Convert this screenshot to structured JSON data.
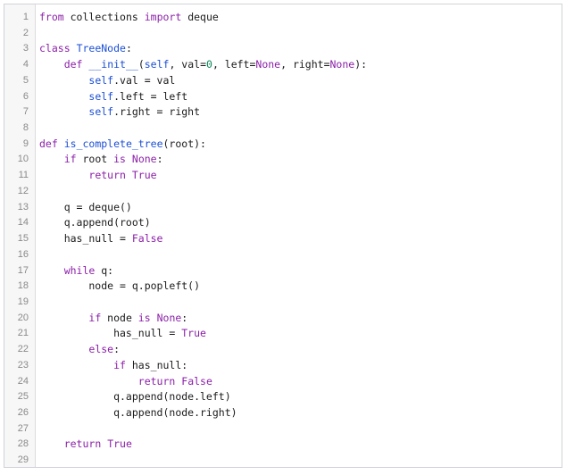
{
  "colors": {
    "default": "#1a1a1a",
    "keyword": "#8b1fa8",
    "builtin": "#1c4fd6",
    "number": "#098658",
    "line_number": "#8a8a8a",
    "gutter_bg": "#f7f7f7"
  },
  "editor": {
    "language": "python",
    "lines": [
      {
        "n": "1",
        "tokens": [
          [
            "kw",
            "from"
          ],
          [
            "t",
            " collections "
          ],
          [
            "kw",
            "import"
          ],
          [
            "t",
            " deque"
          ]
        ]
      },
      {
        "n": "2",
        "tokens": []
      },
      {
        "n": "3",
        "tokens": [
          [
            "kw",
            "class"
          ],
          [
            "t",
            " "
          ],
          [
            "bi",
            "TreeNode"
          ],
          [
            "t",
            ":"
          ]
        ]
      },
      {
        "n": "4",
        "tokens": [
          [
            "t",
            "    "
          ],
          [
            "kw",
            "def"
          ],
          [
            "t",
            " "
          ],
          [
            "bi",
            "__init__"
          ],
          [
            "t",
            "("
          ],
          [
            "bi",
            "self"
          ],
          [
            "t",
            ", val="
          ],
          [
            "num",
            "0"
          ],
          [
            "t",
            ", left="
          ],
          [
            "kw",
            "None"
          ],
          [
            "t",
            ", right="
          ],
          [
            "kw",
            "None"
          ],
          [
            "t",
            "):"
          ]
        ]
      },
      {
        "n": "5",
        "tokens": [
          [
            "t",
            "        "
          ],
          [
            "bi",
            "self"
          ],
          [
            "t",
            ".val = val"
          ]
        ]
      },
      {
        "n": "6",
        "tokens": [
          [
            "t",
            "        "
          ],
          [
            "bi",
            "self"
          ],
          [
            "t",
            ".left = left"
          ]
        ]
      },
      {
        "n": "7",
        "tokens": [
          [
            "t",
            "        "
          ],
          [
            "bi",
            "self"
          ],
          [
            "t",
            ".right = right"
          ]
        ]
      },
      {
        "n": "8",
        "tokens": []
      },
      {
        "n": "9",
        "tokens": [
          [
            "kw",
            "def"
          ],
          [
            "t",
            " "
          ],
          [
            "bi",
            "is_complete_tree"
          ],
          [
            "t",
            "(root):"
          ]
        ]
      },
      {
        "n": "10",
        "tokens": [
          [
            "t",
            "    "
          ],
          [
            "kw",
            "if"
          ],
          [
            "t",
            " root "
          ],
          [
            "kw",
            "is"
          ],
          [
            "t",
            " "
          ],
          [
            "kw",
            "None"
          ],
          [
            "t",
            ":"
          ]
        ]
      },
      {
        "n": "11",
        "tokens": [
          [
            "t",
            "        "
          ],
          [
            "kw",
            "return"
          ],
          [
            "t",
            " "
          ],
          [
            "kw",
            "True"
          ]
        ]
      },
      {
        "n": "12",
        "tokens": []
      },
      {
        "n": "13",
        "tokens": [
          [
            "t",
            "    q = deque()"
          ]
        ]
      },
      {
        "n": "14",
        "tokens": [
          [
            "t",
            "    q.append(root)"
          ]
        ]
      },
      {
        "n": "15",
        "tokens": [
          [
            "t",
            "    has_null = "
          ],
          [
            "kw",
            "False"
          ]
        ]
      },
      {
        "n": "16",
        "tokens": []
      },
      {
        "n": "17",
        "tokens": [
          [
            "t",
            "    "
          ],
          [
            "kw",
            "while"
          ],
          [
            "t",
            " q:"
          ]
        ]
      },
      {
        "n": "18",
        "tokens": [
          [
            "t",
            "        node = q.popleft()"
          ]
        ]
      },
      {
        "n": "19",
        "tokens": []
      },
      {
        "n": "20",
        "tokens": [
          [
            "t",
            "        "
          ],
          [
            "kw",
            "if"
          ],
          [
            "t",
            " node "
          ],
          [
            "kw",
            "is"
          ],
          [
            "t",
            " "
          ],
          [
            "kw",
            "None"
          ],
          [
            "t",
            ":"
          ]
        ]
      },
      {
        "n": "21",
        "tokens": [
          [
            "t",
            "            has_null = "
          ],
          [
            "kw",
            "True"
          ]
        ]
      },
      {
        "n": "22",
        "tokens": [
          [
            "t",
            "        "
          ],
          [
            "kw",
            "else"
          ],
          [
            "t",
            ":"
          ]
        ]
      },
      {
        "n": "23",
        "tokens": [
          [
            "t",
            "            "
          ],
          [
            "kw",
            "if"
          ],
          [
            "t",
            " has_null:"
          ]
        ]
      },
      {
        "n": "24",
        "tokens": [
          [
            "t",
            "                "
          ],
          [
            "kw",
            "return"
          ],
          [
            "t",
            " "
          ],
          [
            "kw",
            "False"
          ]
        ]
      },
      {
        "n": "25",
        "tokens": [
          [
            "t",
            "            q.append(node.left)"
          ]
        ]
      },
      {
        "n": "26",
        "tokens": [
          [
            "t",
            "            q.append(node.right)"
          ]
        ]
      },
      {
        "n": "27",
        "tokens": []
      },
      {
        "n": "28",
        "tokens": [
          [
            "t",
            "    "
          ],
          [
            "kw",
            "return"
          ],
          [
            "t",
            " "
          ],
          [
            "kw",
            "True"
          ]
        ]
      },
      {
        "n": "29",
        "tokens": []
      }
    ]
  }
}
